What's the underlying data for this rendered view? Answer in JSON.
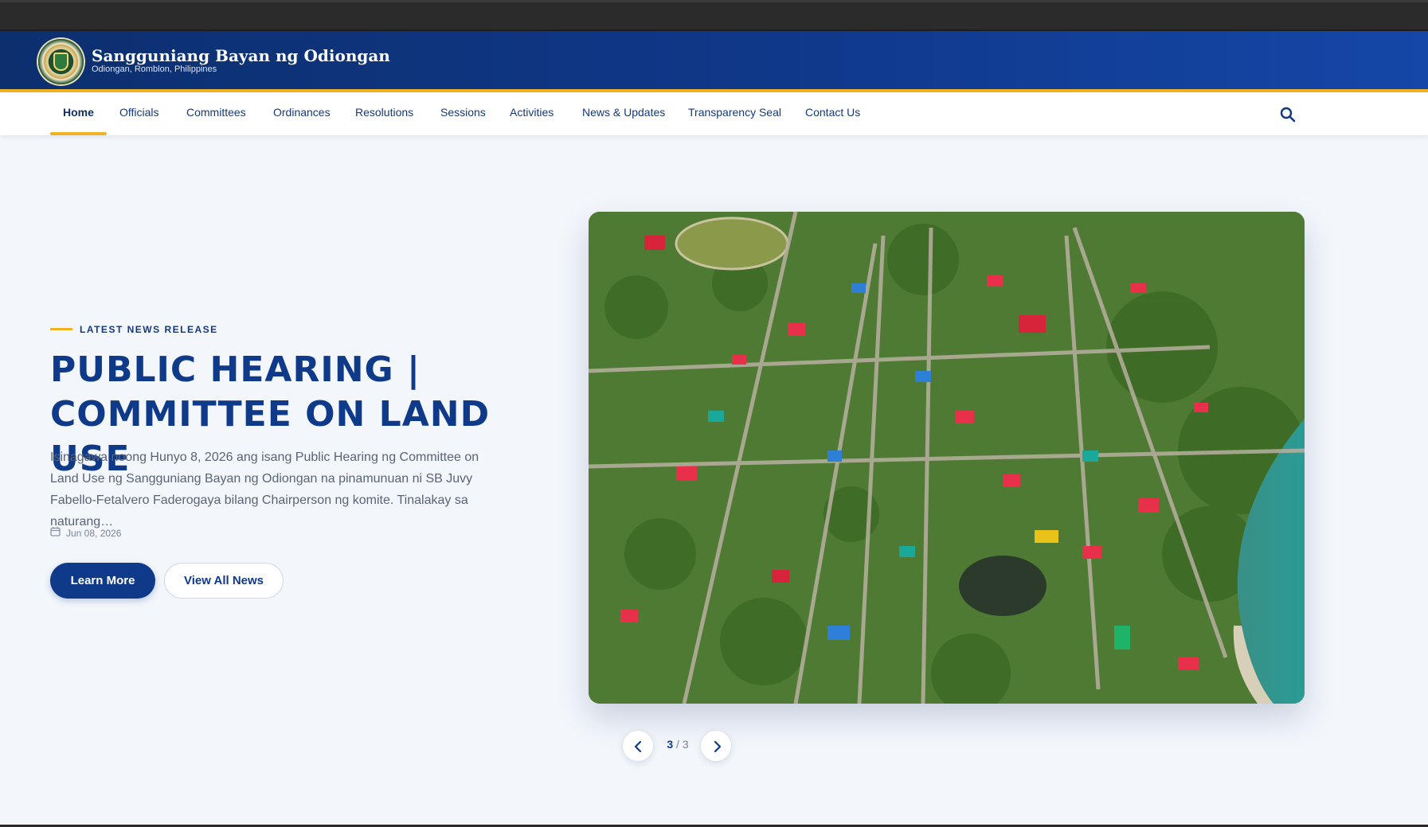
{
  "header": {
    "title": "Sangguniang Bayan ng Odiongan",
    "subtitle": "Odiongan, Romblon, Philippines"
  },
  "nav": {
    "items": [
      {
        "label": "Home",
        "active": true
      },
      {
        "label": "Officials"
      },
      {
        "label": "Committees"
      },
      {
        "label": "Ordinances"
      },
      {
        "label": "Resolutions"
      },
      {
        "label": "Sessions"
      },
      {
        "label": "Activities"
      },
      {
        "label": "News & Updates"
      },
      {
        "label": "Transparency Seal"
      },
      {
        "label": "Contact Us"
      }
    ],
    "search_icon": "search-icon"
  },
  "hero": {
    "eyebrow": "LATEST NEWS RELEASE",
    "title": "PUBLIC HEARING | COMMITTEE ON LAND USE",
    "body": "Isinagawa noong Hunyo 8, 2026 ang isang Public Hearing ng Committee on Land Use ng Sangguniang Bayan ng Odiongan na pinamunuan ni SB Juvy Fabello-Fetalvero Faderogaya bilang Chairperson ng komite. Tinalakay sa naturang…",
    "date": "Jun 08, 2026",
    "primary_button": "Learn More",
    "secondary_button": "View All News"
  },
  "carousel": {
    "current": "3",
    "separator": "/",
    "total": "3"
  },
  "colors": {
    "brand_blue": "#0f3a8a",
    "accent_gold": "#f0b323",
    "header_gradient_start": "#0c2f6e",
    "header_gradient_end": "#1447a8"
  }
}
